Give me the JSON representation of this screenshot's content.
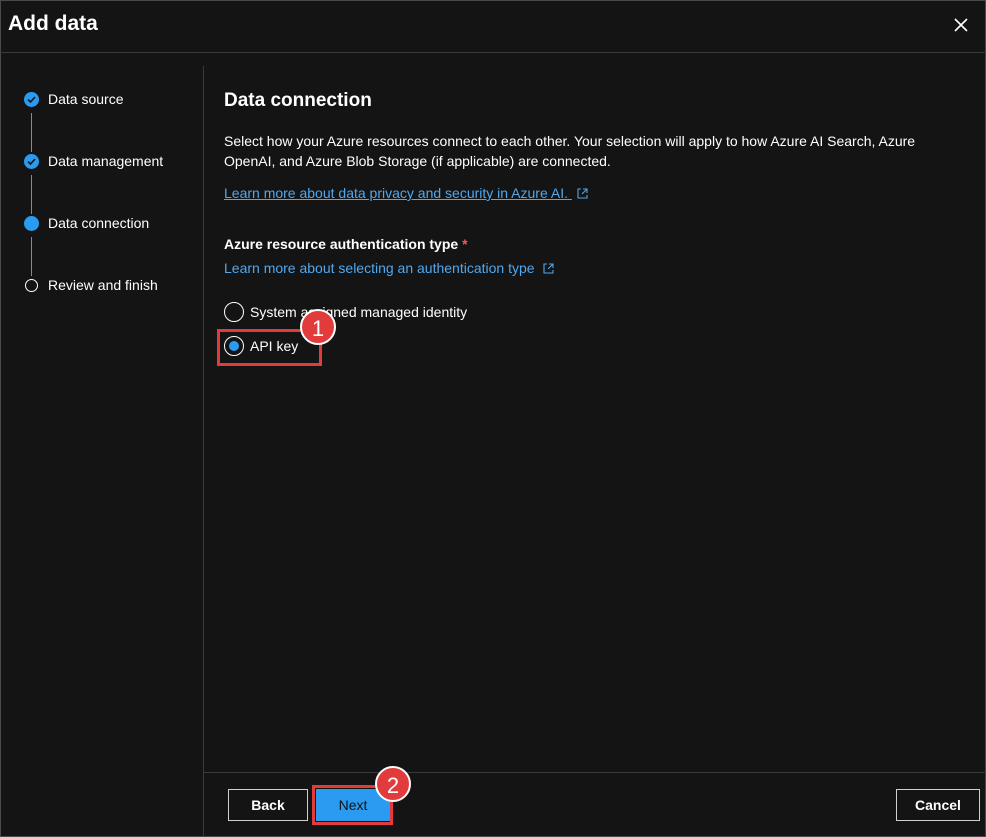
{
  "dialog": {
    "title": "Add data",
    "close_icon": "close-icon"
  },
  "steps": [
    {
      "label": "Data source",
      "state": "completed"
    },
    {
      "label": "Data management",
      "state": "completed"
    },
    {
      "label": "Data connection",
      "state": "current"
    },
    {
      "label": "Review and finish",
      "state": "pending"
    }
  ],
  "main": {
    "heading": "Data connection",
    "description": "Select how your Azure resources connect to each other. Your selection will apply to how Azure AI Search, Azure OpenAI, and Azure Blob Storage (if applicable) are connected.",
    "privacy_link": "Learn more about data privacy and security in Azure AI.",
    "auth_label": "Azure resource authentication type",
    "required_marker": "*",
    "auth_link": "Learn more about selecting an authentication type",
    "options": [
      {
        "label": "System assigned managed identity",
        "selected": false
      },
      {
        "label": "API key",
        "selected": true
      }
    ]
  },
  "annotations": {
    "badge_1": "1",
    "badge_2": "2",
    "highlight_color": "#e23b3b"
  },
  "footer": {
    "back_label": "Back",
    "next_label": "Next",
    "cancel_label": "Cancel"
  },
  "colors": {
    "accent": "#2a9bf0",
    "link": "#4fa8f0",
    "background": "#141414"
  }
}
